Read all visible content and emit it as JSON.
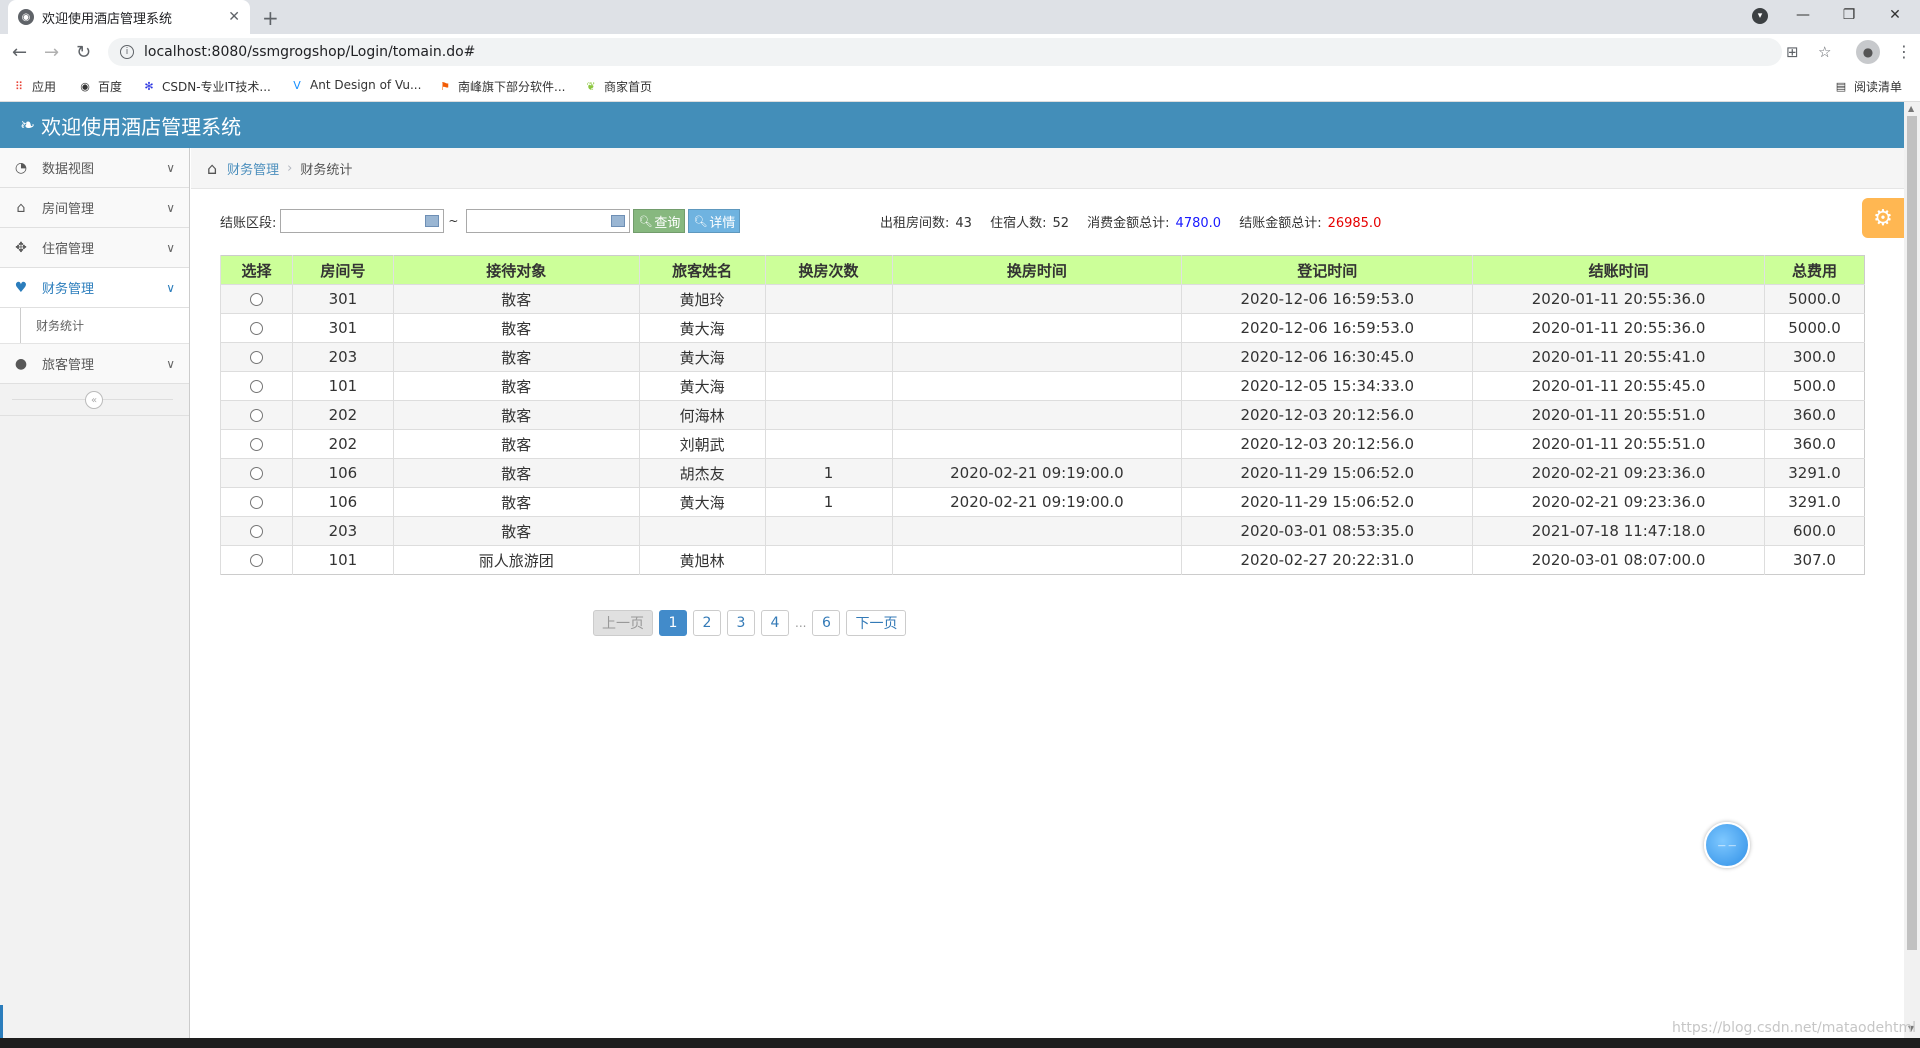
{
  "browser": {
    "tab_title": "欢迎使用酒店管理系统",
    "url": "localhost:8080/ssmgrogshop/Login/tomain.do#",
    "bookmarks": [
      "应用",
      "百度",
      "CSDN-专业IT技术...",
      "Ant Design of Vu...",
      "南峰旗下部分软件...",
      "商家首页"
    ],
    "reading_list": "阅读清单"
  },
  "app": {
    "title": "欢迎使用酒店管理系统"
  },
  "sidebar": {
    "items": [
      {
        "label": "数据视图"
      },
      {
        "label": "房间管理"
      },
      {
        "label": "住宿管理"
      },
      {
        "label": "财务管理"
      },
      {
        "label": "旅客管理"
      }
    ],
    "sub_item": "财务统计"
  },
  "breadcrumb": {
    "parent": "财务管理",
    "current": "财务统计"
  },
  "filter": {
    "label": "结账区段:",
    "start_value": "",
    "end_value": "",
    "tilde": "~",
    "query_button": "查询",
    "detail_button": "详情"
  },
  "stats": {
    "rooms_label": "出租房间数:",
    "rooms_value": "43",
    "guests_label": "住宿人数:",
    "guests_value": "52",
    "consume_label": "消费金额总计:",
    "consume_value": "4780.0",
    "checkout_label": "结账金额总计:",
    "checkout_value": "26985.0"
  },
  "table": {
    "headers": [
      "选择",
      "房间号",
      "接待对象",
      "旅客姓名",
      "换房次数",
      "换房时间",
      "登记时间",
      "结账时间",
      "总费用"
    ],
    "rows": [
      [
        "",
        "301",
        "散客",
        "黄旭玲",
        "",
        "",
        "2020-12-06 16:59:53.0",
        "2020-01-11 20:55:36.0",
        "5000.0"
      ],
      [
        "",
        "301",
        "散客",
        "黄大海",
        "",
        "",
        "2020-12-06 16:59:53.0",
        "2020-01-11 20:55:36.0",
        "5000.0"
      ],
      [
        "",
        "203",
        "散客",
        "黄大海",
        "",
        "",
        "2020-12-06 16:30:45.0",
        "2020-01-11 20:55:41.0",
        "300.0"
      ],
      [
        "",
        "101",
        "散客",
        "黄大海",
        "",
        "",
        "2020-12-05 15:34:33.0",
        "2020-01-11 20:55:45.0",
        "500.0"
      ],
      [
        "",
        "202",
        "散客",
        "何海林",
        "",
        "",
        "2020-12-03 20:12:56.0",
        "2020-01-11 20:55:51.0",
        "360.0"
      ],
      [
        "",
        "202",
        "散客",
        "刘朝武",
        "",
        "",
        "2020-12-03 20:12:56.0",
        "2020-01-11 20:55:51.0",
        "360.0"
      ],
      [
        "",
        "106",
        "散客",
        "胡杰友",
        "1",
        "2020-02-21 09:19:00.0",
        "2020-11-29 15:06:52.0",
        "2020-02-21 09:23:36.0",
        "3291.0"
      ],
      [
        "",
        "106",
        "散客",
        "黄大海",
        "1",
        "2020-02-21 09:19:00.0",
        "2020-11-29 15:06:52.0",
        "2020-02-21 09:23:36.0",
        "3291.0"
      ],
      [
        "",
        "203",
        "散客",
        "",
        "",
        "",
        "2020-03-01 08:53:35.0",
        "2021-07-18 11:47:18.0",
        "600.0"
      ],
      [
        "",
        "101",
        "丽人旅游团",
        "黄旭林",
        "",
        "",
        "2020-02-27 20:22:31.0",
        "2020-03-01 08:07:00.0",
        "307.0"
      ]
    ]
  },
  "pager": {
    "prev": "上一页",
    "pages": [
      "1",
      "2",
      "3",
      "4"
    ],
    "dots": "...",
    "last": "6",
    "next": "下一页"
  },
  "watermark": "https://blog.csdn.net/mataodehtml",
  "colors": {
    "header": "#438eb9",
    "table_header": "#ccff99",
    "accent_blue": "#2b7dbc",
    "consume_value": "#1a1aff",
    "checkout_value": "#e60000"
  }
}
